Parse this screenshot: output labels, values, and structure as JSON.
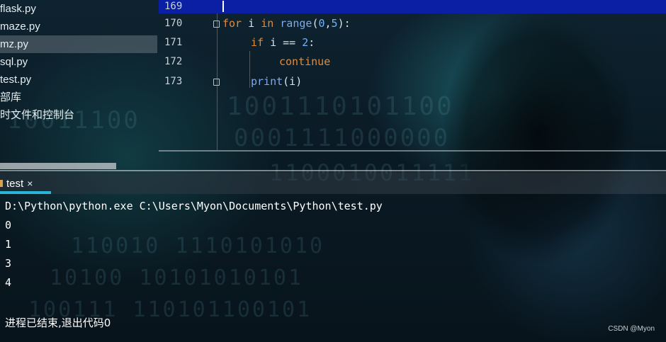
{
  "project_tree": {
    "items": [
      {
        "label": "flask.py",
        "selected": false
      },
      {
        "label": "maze.py",
        "selected": false
      },
      {
        "label": "mz.py",
        "selected": true
      },
      {
        "label": "sql.py",
        "selected": false
      },
      {
        "label": "test.py",
        "selected": false
      },
      {
        "label": "部库",
        "selected": false
      },
      {
        "label": "时文件和控制台",
        "selected": false
      }
    ]
  },
  "editor": {
    "lines": [
      {
        "number": "169"
      },
      {
        "number": "170"
      },
      {
        "number": "171"
      },
      {
        "number": "172"
      },
      {
        "number": "173"
      }
    ],
    "code": {
      "line170": {
        "kw_for": "for",
        "var": " i ",
        "kw_in": "in",
        "fn": " range",
        "open": "(",
        "start": "0",
        "comma": ",",
        "end": "5",
        "close": "):"
      },
      "line171": {
        "kw_if": "if",
        "cond": " i == ",
        "num": "2",
        "colon": ":"
      },
      "line172": {
        "kw_continue": "continue"
      },
      "line173": {
        "fn": "print",
        "args": "(i)"
      }
    }
  },
  "run_panel": {
    "tab_label": "test",
    "tab_close": "×",
    "console": [
      "D:\\Python\\python.exe C:\\Users\\Myon\\Documents\\Python\\test.py",
      "0",
      "1",
      "3",
      "4"
    ],
    "exit_message": "进程已结束,退出代码0"
  },
  "watermark": "CSDN @Myon⁠"
}
